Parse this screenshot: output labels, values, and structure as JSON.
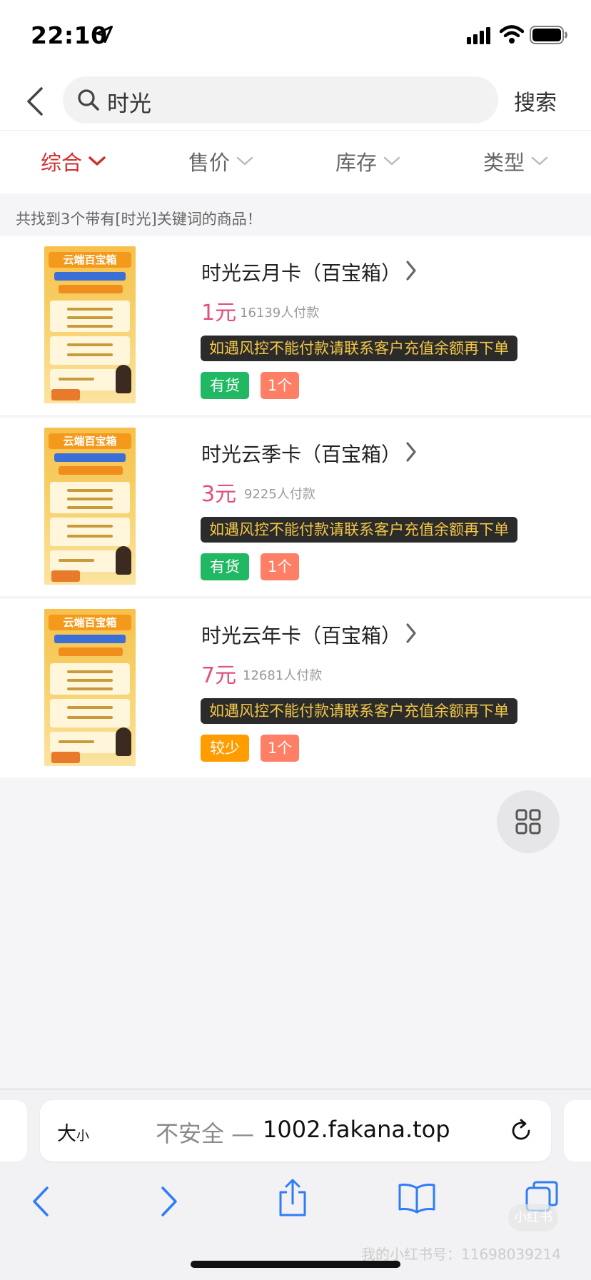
{
  "status_bar": {
    "time": "22:10"
  },
  "search": {
    "query": "时光",
    "button_label": "搜索"
  },
  "filters": [
    {
      "label": "综合",
      "active": true
    },
    {
      "label": "售价",
      "active": false
    },
    {
      "label": "库存",
      "active": false
    },
    {
      "label": "类型",
      "active": false
    }
  ],
  "result_hint": "共找到3个带有[时光]关键词的商品！",
  "products": [
    {
      "title": "时光云月卡（百宝箱）",
      "price": "1元",
      "sold": "16139人付款",
      "note": "如遇风控不能付款请联系客户充值余额再下单",
      "stock_label": "有货",
      "stock_color": "#21b863",
      "qty_label": "1个",
      "thumb_title": "云端百宝箱"
    },
    {
      "title": "时光云季卡（百宝箱）",
      "price": "3元",
      "sold": "9225人付款",
      "note": "如遇风控不能付款请联系客户充值余额再下单",
      "stock_label": "有货",
      "stock_color": "#21b863",
      "qty_label": "1个",
      "thumb_title": "云端百宝箱"
    },
    {
      "title": "时光云年卡（百宝箱）",
      "price": "7元",
      "sold": "12681人付款",
      "note": "如遇风控不能付款请联系客户充值余额再下单",
      "stock_label": "较少",
      "stock_color": "#ff9d00",
      "qty_label": "1个",
      "thumb_title": "云端百宝箱"
    }
  ],
  "browser": {
    "text_size_label": "大",
    "text_size_small": "小",
    "insecure_label": "不安全 —",
    "domain": "1002.fakana.top"
  },
  "watermark": {
    "id_text": "我的小红书号：11698039214",
    "logo_text": "小红书"
  },
  "colors": {
    "accent_red": "#d12e2e",
    "price_pink": "#e0517b",
    "ios_blue": "#2f7cf6"
  }
}
